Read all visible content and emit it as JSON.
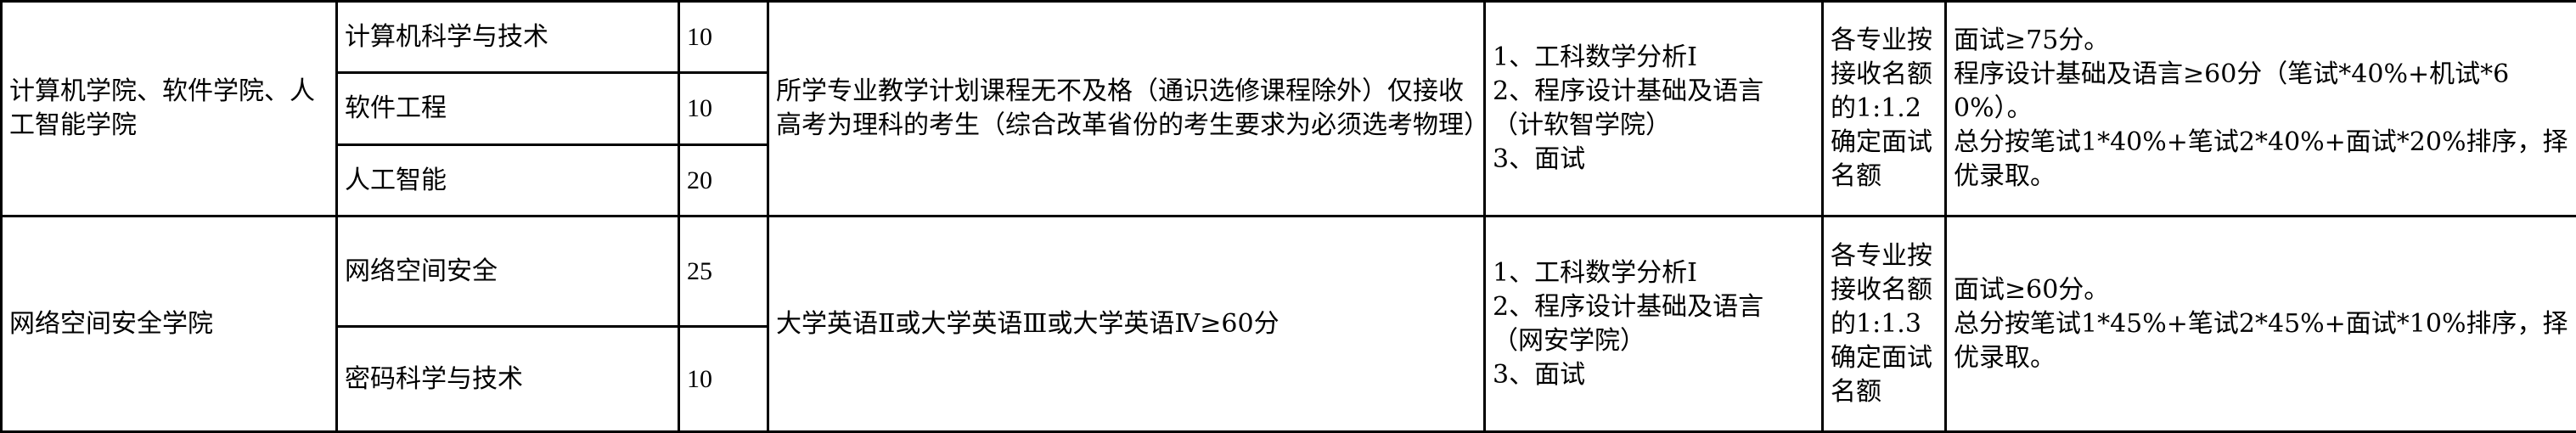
{
  "groups": [
    {
      "college": "计算机学院、软件学院、人工智能学院",
      "majors": [
        {
          "name": "计算机科学与技术",
          "quota": "10"
        },
        {
          "name": "软件工程",
          "quota": "10"
        },
        {
          "name": "人工智能",
          "quota": "20"
        }
      ],
      "requirement": "所学专业教学计划课程无不及格（通识选修课程除外）仅接收高考为理科的考生（综合改革省份的考生要求为必须选考物理）",
      "exam_items": [
        "1、工科数学分析I",
        "2、程序设计基础及语言（计软智学院）",
        "3、面试"
      ],
      "interview_ratio": "各专业按接收名额的1:1.2确定面试名额",
      "scoring": [
        "面试≥75分。",
        "程序设计基础及语言≥60分（笔试*40%+机试*60%）。",
        "总分按笔试1*40%+笔试2*40%+面试*20%排序，择优录取。"
      ]
    },
    {
      "college": "网络空间安全学院",
      "majors": [
        {
          "name": "网络空间安全",
          "quota": "25"
        },
        {
          "name": "密码科学与技术",
          "quota": "10"
        }
      ],
      "requirement": "大学英语Ⅱ或大学英语Ⅲ或大学英语Ⅳ≥60分",
      "exam_items": [
        "1、工科数学分析I",
        "2、程序设计基础及语言（网安学院）",
        "3、面试"
      ],
      "interview_ratio": "各专业按接收名额的1:1.3确定面试名额",
      "scoring": [
        "面试≥60分。",
        "总分按笔试1*45%+笔试2*45%+面试*10%排序，择优录取。"
      ]
    }
  ]
}
